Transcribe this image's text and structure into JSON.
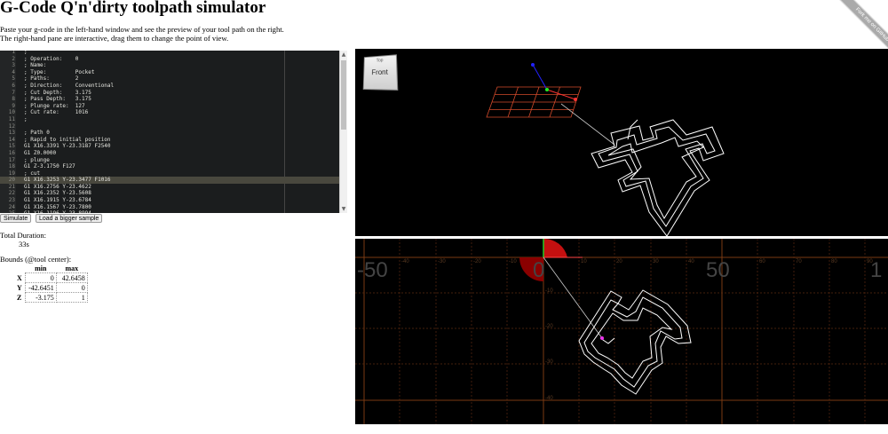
{
  "page": {
    "title": "G-Code Q'n'dirty toolpath simulator",
    "intro_line1": "Paste your g-code in the left-hand window and see the preview of your tool path on the right.",
    "intro_line2": "The right-hand pane are interactive, drag them to change the point of view.",
    "ribbon": "Fork me on GitHub"
  },
  "editor": {
    "lines": [
      {
        "n": "1",
        "t": ";"
      },
      {
        "n": "2",
        "t": "; Operation:    0"
      },
      {
        "n": "3",
        "t": "; Name:"
      },
      {
        "n": "4",
        "t": "; Type:         Pocket"
      },
      {
        "n": "5",
        "t": "; Paths:        2"
      },
      {
        "n": "6",
        "t": "; Direction:    Conventional"
      },
      {
        "n": "7",
        "t": "; Cut Depth:    3.175"
      },
      {
        "n": "8",
        "t": "; Pass Depth:   3.175"
      },
      {
        "n": "9",
        "t": "; Plunge rate:  127"
      },
      {
        "n": "10",
        "t": "; Cut rate:     1016"
      },
      {
        "n": "11",
        "t": ";"
      },
      {
        "n": "12",
        "t": ""
      },
      {
        "n": "13",
        "t": "; Path 0"
      },
      {
        "n": "14",
        "t": "; Rapid to initial position"
      },
      {
        "n": "15",
        "t": "G1 X16.3391 Y-23.3187 F2540"
      },
      {
        "n": "16",
        "t": "G1 Z0.0000"
      },
      {
        "n": "17",
        "t": "; plunge"
      },
      {
        "n": "18",
        "t": "G1 Z-3.1750 F127"
      },
      {
        "n": "19",
        "t": "; cut"
      },
      {
        "n": "20",
        "t": "G1 X16.3253 Y-23.3477 F1016"
      },
      {
        "n": "21",
        "t": "G1 X16.2756 Y-23.4622"
      },
      {
        "n": "22",
        "t": "G1 X16.2352 Y-23.5608"
      },
      {
        "n": "23",
        "t": "G1 X16.1915 Y-23.6784"
      },
      {
        "n": "24",
        "t": "G1 X16.1567 Y-23.7800"
      },
      {
        "n": "25",
        "t": "G1 X16.1196 Y-23.8994"
      },
      {
        "n": "26",
        "t": "G1 X16.0888 Y-24.0159"
      },
      {
        "n": "27",
        "t": "G1 X16.0636 Y-24.1342"
      }
    ],
    "highlight_index": 19
  },
  "buttons": {
    "simulate": "Simulate",
    "load_sample": "Load a bigger sample"
  },
  "duration": {
    "label": "Total Duration:",
    "value": "33s"
  },
  "bounds": {
    "label": "Bounds (@tool center):",
    "col_min": "min",
    "col_max": "max",
    "rows": [
      {
        "axis": "X",
        "min": "0",
        "max": "42.6458"
      },
      {
        "axis": "Y",
        "min": "-42.6451",
        "max": "0"
      },
      {
        "axis": "Z",
        "min": "-3.175",
        "max": "1"
      }
    ]
  },
  "view3d": {
    "cube_face": "Front",
    "cube_top": "Top"
  },
  "view2d": {
    "axis_labels_big": [
      "-50",
      "0",
      "50",
      "1"
    ],
    "axis_labels_small": [
      "-40",
      "-30",
      "-20",
      "-10",
      "10",
      "20",
      "30",
      "40",
      "60",
      "70",
      "80",
      "90"
    ],
    "y_labels": [
      "-10",
      "-20",
      "-30",
      "-40"
    ]
  },
  "colors": {
    "editor_bg": "#1b1d1e",
    "highlight": "#49483e",
    "viewport_bg": "#000000",
    "grid": "#7a3a12",
    "toolpath": "#ffffff"
  }
}
